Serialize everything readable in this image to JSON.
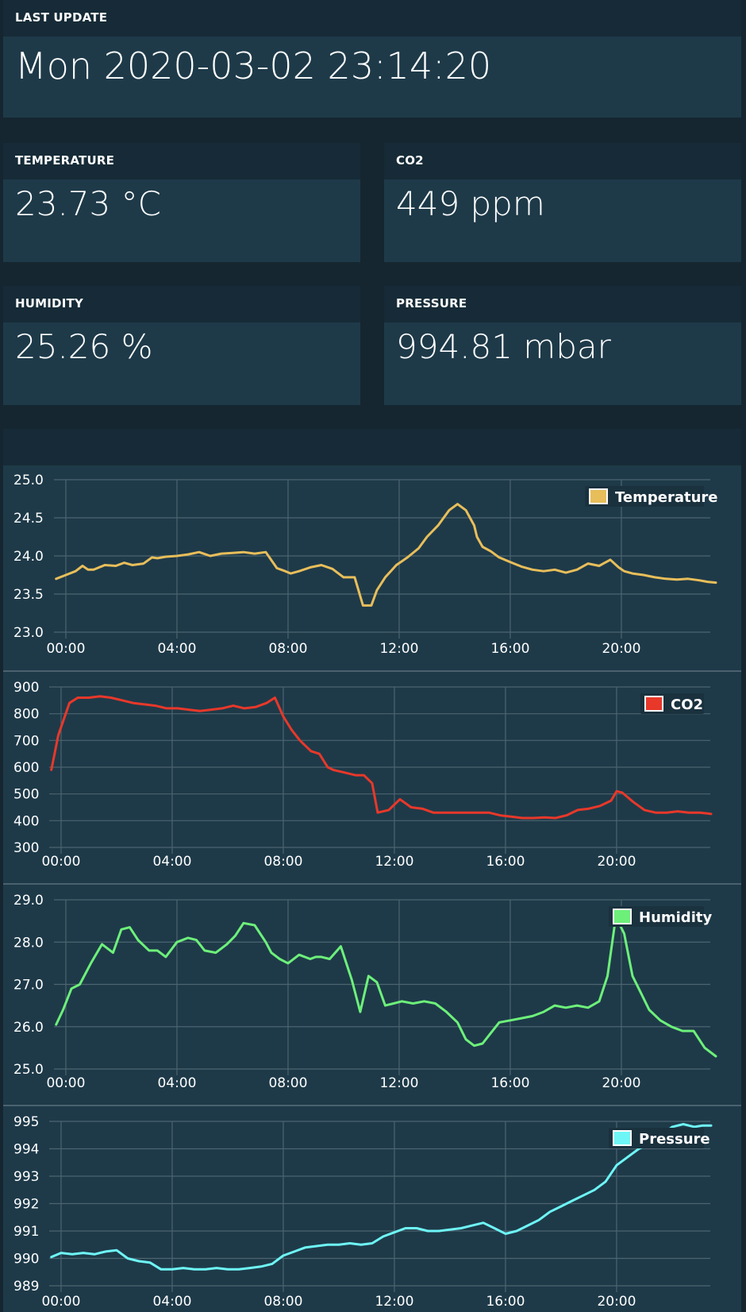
{
  "last_update": {
    "label": "LAST UPDATE",
    "value": "Mon 2020-03-02 23:14:20"
  },
  "cards": {
    "temperature": {
      "label": "TEMPERATURE",
      "value": "23.73 °C"
    },
    "co2": {
      "label": "CO2",
      "value": "449 ppm"
    },
    "humidity": {
      "label": "HUMIDITY",
      "value": "25.26 %"
    },
    "pressure": {
      "label": "PRESSURE",
      "value": "994.81 mbar"
    }
  },
  "colors": {
    "temperature": "#e8be5a",
    "co2": "#e8382a",
    "humidity": "#6df07a",
    "pressure": "#6ef6f6",
    "panel": "#1e3a49",
    "panel_header": "#162b37",
    "grid": "#4d6470"
  },
  "chart_data": [
    {
      "type": "line",
      "title": "",
      "xlabel": "",
      "ylabel": "",
      "xlim": [
        0,
        23.4
      ],
      "ylim": [
        23.0,
        25.0
      ],
      "x_ticks": [
        "00:00",
        "04:00",
        "08:00",
        "12:00",
        "16:00",
        "20:00"
      ],
      "y_ticks": [
        "23.0",
        "23.5",
        "24.0",
        "24.5",
        "25.0"
      ],
      "grid": true,
      "legend_position": "top-right",
      "series": [
        {
          "name": "Temperature",
          "x": [
            -0.35,
            0,
            0.35,
            0.6,
            0.8,
            1.0,
            1.4,
            1.8,
            2.1,
            2.4,
            2.8,
            3.1,
            3.3,
            3.6,
            4.0,
            4.4,
            4.8,
            5.2,
            5.6,
            6.0,
            6.4,
            6.8,
            7.2,
            7.6,
            7.9,
            8.1,
            8.4,
            8.8,
            9.2,
            9.6,
            10.0,
            10.4,
            10.7,
            11.0,
            11.2,
            11.5,
            11.7,
            11.9,
            12.3,
            12.7,
            13.0,
            13.4,
            13.8,
            14.1,
            14.4,
            14.7,
            14.8,
            15.0,
            15.3,
            15.6,
            16.0,
            16.4,
            16.8,
            17.2,
            17.6,
            18.0,
            18.4,
            18.8,
            19.2,
            19.6,
            19.9,
            20.1,
            20.4,
            20.8,
            21.2,
            21.6,
            22.0,
            22.4,
            22.8,
            23.1,
            23.4
          ],
          "values": [
            23.7,
            23.75,
            23.8,
            23.87,
            23.82,
            23.82,
            23.88,
            23.87,
            23.91,
            23.88,
            23.9,
            23.98,
            23.97,
            23.99,
            24.0,
            24.02,
            24.05,
            24.0,
            24.03,
            24.04,
            24.05,
            24.03,
            24.05,
            23.84,
            23.8,
            23.77,
            23.8,
            23.85,
            23.88,
            23.83,
            23.72,
            23.72,
            23.35,
            23.35,
            23.55,
            23.72,
            23.8,
            23.88,
            23.98,
            24.1,
            24.25,
            24.4,
            24.6,
            24.68,
            24.6,
            24.4,
            24.25,
            24.12,
            24.06,
            23.98,
            23.92,
            23.86,
            23.82,
            23.8,
            23.82,
            23.78,
            23.82,
            23.9,
            23.87,
            23.95,
            23.85,
            23.8,
            23.77,
            23.75,
            23.72,
            23.7,
            23.69,
            23.7,
            23.68,
            23.66,
            23.65
          ]
        }
      ]
    },
    {
      "type": "line",
      "title": "",
      "xlabel": "",
      "ylabel": "",
      "xlim": [
        0,
        23.4
      ],
      "ylim": [
        300,
        900
      ],
      "x_ticks": [
        "00:00",
        "04:00",
        "08:00",
        "12:00",
        "16:00",
        "20:00"
      ],
      "y_ticks": [
        "300",
        "400",
        "500",
        "600",
        "700",
        "800",
        "900"
      ],
      "grid": true,
      "legend_position": "top-right",
      "series": [
        {
          "name": "CO2",
          "x": [
            -0.35,
            -0.1,
            0.3,
            0.6,
            1.0,
            1.4,
            1.8,
            2.2,
            2.6,
            3.0,
            3.4,
            3.8,
            4.2,
            4.6,
            5.0,
            5.4,
            5.8,
            6.2,
            6.6,
            7.0,
            7.4,
            7.7,
            8.0,
            8.3,
            8.6,
            9.0,
            9.3,
            9.6,
            9.8,
            10.2,
            10.6,
            10.9,
            11.2,
            11.4,
            11.8,
            12.2,
            12.6,
            13.0,
            13.4,
            13.8,
            14.2,
            14.6,
            15.0,
            15.4,
            15.8,
            16.2,
            16.6,
            17.0,
            17.4,
            17.8,
            18.2,
            18.6,
            19.0,
            19.4,
            19.8,
            20.0,
            20.2,
            20.6,
            21.0,
            21.4,
            21.8,
            22.2,
            22.6,
            23.0,
            23.4
          ],
          "values": [
            590,
            720,
            840,
            860,
            860,
            865,
            860,
            850,
            840,
            835,
            830,
            820,
            820,
            815,
            810,
            815,
            820,
            830,
            820,
            825,
            840,
            860,
            790,
            740,
            700,
            660,
            650,
            600,
            590,
            580,
            570,
            570,
            540,
            430,
            440,
            480,
            450,
            445,
            430,
            430,
            430,
            430,
            430,
            430,
            420,
            415,
            410,
            410,
            412,
            410,
            420,
            440,
            445,
            455,
            475,
            510,
            505,
            470,
            440,
            430,
            430,
            435,
            430,
            430,
            425
          ]
        }
      ]
    },
    {
      "type": "line",
      "title": "",
      "xlabel": "",
      "ylabel": "",
      "xlim": [
        0,
        23.4
      ],
      "ylim": [
        25.0,
        29.0
      ],
      "x_ticks": [
        "00:00",
        "04:00",
        "08:00",
        "12:00",
        "16:00",
        "20:00"
      ],
      "y_ticks": [
        "25.0",
        "26.0",
        "27.0",
        "28.0",
        "29.0"
      ],
      "grid": true,
      "legend_position": "top-right",
      "series": [
        {
          "name": "Humidity",
          "x": [
            -0.35,
            -0.1,
            0.2,
            0.5,
            0.9,
            1.3,
            1.7,
            2.0,
            2.3,
            2.6,
            3.0,
            3.3,
            3.6,
            4.0,
            4.4,
            4.7,
            5.0,
            5.4,
            5.8,
            6.1,
            6.4,
            6.8,
            7.2,
            7.4,
            7.7,
            8.0,
            8.4,
            8.8,
            9.0,
            9.2,
            9.5,
            9.9,
            10.3,
            10.6,
            10.9,
            11.2,
            11.5,
            11.8,
            12.1,
            12.5,
            12.9,
            13.3,
            13.7,
            14.1,
            14.4,
            14.7,
            15.0,
            15.3,
            15.6,
            16.0,
            16.4,
            16.8,
            17.2,
            17.6,
            18.0,
            18.4,
            18.8,
            19.2,
            19.5,
            19.8,
            20.1,
            20.4,
            20.7,
            21.0,
            21.4,
            21.8,
            22.2,
            22.6,
            23.0,
            23.4
          ],
          "values": [
            26.05,
            26.4,
            26.9,
            27.0,
            27.5,
            27.95,
            27.75,
            28.3,
            28.35,
            28.05,
            27.8,
            27.8,
            27.65,
            28.0,
            28.1,
            28.05,
            27.8,
            27.75,
            27.95,
            28.15,
            28.45,
            28.4,
            28.0,
            27.75,
            27.6,
            27.5,
            27.7,
            27.6,
            27.65,
            27.65,
            27.6,
            27.9,
            27.1,
            26.35,
            27.2,
            27.05,
            26.5,
            26.55,
            26.6,
            26.55,
            26.6,
            26.55,
            26.35,
            26.1,
            25.7,
            25.55,
            25.6,
            25.85,
            26.1,
            26.15,
            26.2,
            26.25,
            26.35,
            26.5,
            26.45,
            26.5,
            26.45,
            26.6,
            27.2,
            28.6,
            28.2,
            27.2,
            26.8,
            26.4,
            26.15,
            26.0,
            25.9,
            25.9,
            25.5,
            25.3
          ]
        }
      ]
    },
    {
      "type": "line",
      "title": "",
      "xlabel": "",
      "ylabel": "",
      "xlim": [
        0,
        23.4
      ],
      "ylim": [
        989,
        995
      ],
      "x_ticks": [
        "00:00",
        "04:00",
        "08:00",
        "12:00",
        "16:00",
        "20:00"
      ],
      "y_ticks": [
        "989",
        "990",
        "991",
        "992",
        "993",
        "994",
        "995"
      ],
      "grid": true,
      "legend_position": "top-right",
      "series": [
        {
          "name": "Pressure",
          "x": [
            -0.35,
            0,
            0.4,
            0.8,
            1.2,
            1.6,
            2.0,
            2.4,
            2.8,
            3.2,
            3.6,
            4.0,
            4.4,
            4.8,
            5.2,
            5.6,
            6.0,
            6.4,
            6.8,
            7.2,
            7.6,
            8.0,
            8.4,
            8.8,
            9.2,
            9.6,
            10.0,
            10.4,
            10.8,
            11.2,
            11.6,
            12.0,
            12.4,
            12.8,
            13.2,
            13.6,
            14.0,
            14.4,
            14.8,
            15.2,
            15.6,
            16.0,
            16.4,
            16.8,
            17.2,
            17.6,
            18.0,
            18.4,
            18.8,
            19.2,
            19.6,
            20.0,
            20.4,
            20.8,
            21.2,
            21.6,
            22.0,
            22.4,
            22.8,
            23.1,
            23.4
          ],
          "values": [
            990.05,
            990.2,
            990.15,
            990.2,
            990.15,
            990.25,
            990.3,
            990.0,
            989.9,
            989.85,
            989.6,
            989.6,
            989.65,
            989.6,
            989.6,
            989.65,
            989.6,
            989.6,
            989.65,
            989.7,
            989.8,
            990.1,
            990.25,
            990.4,
            990.45,
            990.5,
            990.5,
            990.55,
            990.5,
            990.55,
            990.8,
            990.95,
            991.1,
            991.1,
            991.0,
            991.0,
            991.05,
            991.1,
            991.2,
            991.3,
            991.1,
            990.9,
            991.0,
            991.2,
            991.4,
            991.7,
            991.9,
            992.1,
            992.3,
            992.5,
            992.8,
            993.4,
            993.7,
            994.0,
            994.2,
            994.5,
            994.8,
            994.9,
            994.8,
            994.85,
            994.85
          ]
        }
      ]
    }
  ]
}
